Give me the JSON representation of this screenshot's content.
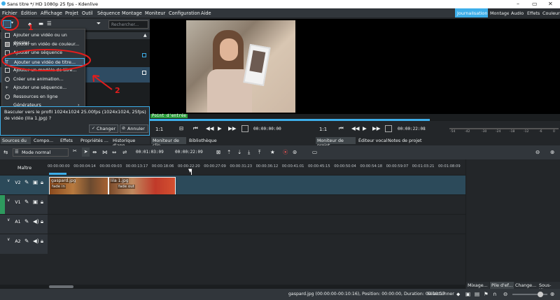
{
  "window": {
    "title": "Sans titre */ HD 1080p 25 fps - Kdenlive",
    "controls": [
      "–",
      "▭",
      "✕"
    ]
  },
  "menu": [
    "Fichier",
    "Édition",
    "Affichage",
    "Projet",
    "Outil",
    "Séquence",
    "Montage",
    "Moniteur",
    "Configuration",
    "Aide"
  ],
  "workspaces": [
    "Journalisation",
    "Montage",
    "Audio",
    "Effets",
    "Couleur"
  ],
  "bin": {
    "search_placeholder": "Rechercher..."
  },
  "add_menu": {
    "items": [
      {
        "label": "Ajouter une vidéo ou un dossier...",
        "icon": "folder-icon"
      },
      {
        "label": "Ajouter un vidéo de couleur...",
        "icon": "color-icon"
      },
      {
        "label": "Ajouter une séquence d'images...",
        "icon": "image-sequence-icon"
      },
      {
        "label": "Ajouter une vidéo de titre...",
        "icon": "title-icon"
      },
      {
        "label": "Ajouter un modèle de titre...",
        "icon": "template-icon"
      },
      {
        "label": "Créer une animation...",
        "icon": "animation-icon"
      },
      {
        "label": "Ajouter une séquence...",
        "icon": "sequence-icon"
      },
      {
        "label": "Ressources en ligne",
        "icon": "globe-icon"
      },
      {
        "label": "Générateurs",
        "icon": "generator-icon",
        "submenu": true
      }
    ]
  },
  "profile_prompt": {
    "text": "Basculer vers le profil 1024x1024 25.00fps (1024x1024, 25fps) de vidéo (lila 1.jpg) ?",
    "change": "Changer",
    "cancel": "Annuler"
  },
  "annotations": {
    "number_1": "1",
    "number_2": "2"
  },
  "left_tabs": [
    "Sources du ...",
    "Compo...",
    "Effets",
    "Propriétés ...",
    "Historique d'ann..."
  ],
  "clip_monitor": {
    "marker": "Point d'entrée",
    "zoom": "1:1",
    "timecode": "00:00:00:00",
    "tab": "Moniteur de clip"
  },
  "library_tab": "Bibliothèque",
  "project_monitor": {
    "zoom": "1:1",
    "timecode": "00:00:22:08",
    "tabs": [
      "Moniteur de projet",
      "Éditeur vocal",
      "Notes de projet"
    ],
    "meter": [
      "-54",
      "-42",
      "-30",
      "-24",
      "-18",
      "-12",
      "-6",
      "0"
    ]
  },
  "timeline": {
    "mode": "Mode normal",
    "position": "00:01:03:09",
    "duration": "00:00:22:09",
    "master": "Maître",
    "ruler": [
      "00:00:00:00",
      "00:00:04:14",
      "00:00:09:03",
      "00:00:13:17",
      "00:00:18:06",
      "00:00:22:20",
      "00:00:27:09",
      "00:00:31:23",
      "00:00:36:12",
      "00:00:41:01",
      "00:00:45:15",
      "00:00:50:04",
      "00:00:54:18",
      "00:00:59:07",
      "00:01:03:21",
      "00:01:08:09"
    ],
    "tracks": [
      {
        "label": "V2",
        "color": "#2e9a5e"
      },
      {
        "label": "V1",
        "color": "#2e9a5e"
      },
      {
        "label": "A1",
        "color": "#2e9a5e"
      },
      {
        "label": "A2",
        "color": "#2e9a5e"
      }
    ],
    "clips": [
      {
        "name": "gaspard.jpg",
        "effect": "fade in"
      },
      {
        "name": "lila 1.jpg",
        "effect": "fade out"
      }
    ]
  },
  "bottom_tabs": [
    "Mixage...",
    "Pile d'ef...",
    "Change...",
    "Sous-tit..."
  ],
  "status": {
    "text": "gaspard.jpg (00:00:00-00:10:16), Position: 00:00:00, Duration: 00:10:17",
    "select": "Sélectionner"
  }
}
